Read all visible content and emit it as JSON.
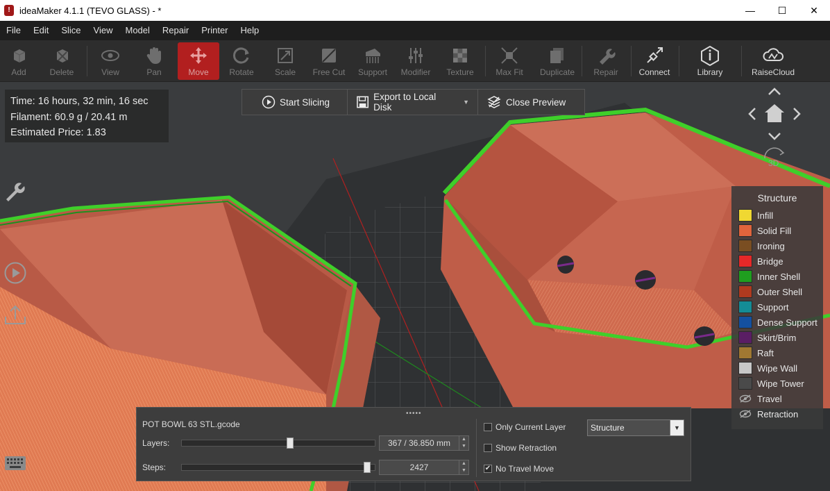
{
  "window": {
    "title": "ideaMaker 4.1.1 (TEVO GLASS) - *",
    "app_icon_glyph": "!",
    "controls": {
      "minimize": "—",
      "maximize": "☐",
      "close": "✕"
    }
  },
  "menu": [
    "File",
    "Edit",
    "Slice",
    "View",
    "Model",
    "Repair",
    "Printer",
    "Help"
  ],
  "toolbar": [
    {
      "label": "Add",
      "icon": "add-model-icon",
      "state": "disabled"
    },
    {
      "label": "Delete",
      "icon": "delete-model-icon",
      "state": "disabled"
    },
    {
      "label": "View",
      "icon": "eye-icon",
      "state": "disabled"
    },
    {
      "label": "Pan",
      "icon": "hand-icon",
      "state": "disabled"
    },
    {
      "label": "Move",
      "icon": "move-arrows-icon",
      "state": "active"
    },
    {
      "label": "Rotate",
      "icon": "rotate-icon",
      "state": "disabled"
    },
    {
      "label": "Scale",
      "icon": "scale-icon",
      "state": "disabled"
    },
    {
      "label": "Free Cut",
      "icon": "cut-icon",
      "state": "disabled"
    },
    {
      "label": "Support",
      "icon": "support-icon",
      "state": "disabled"
    },
    {
      "label": "Modifier",
      "icon": "modifier-icon",
      "state": "disabled"
    },
    {
      "label": "Texture",
      "icon": "texture-icon",
      "state": "disabled"
    },
    {
      "label": "Max Fit",
      "icon": "max-fit-icon",
      "state": "disabled"
    },
    {
      "label": "Duplicate",
      "icon": "duplicate-icon",
      "state": "disabled"
    },
    {
      "label": "Repair",
      "icon": "wrench-icon",
      "state": "disabled"
    },
    {
      "label": "Connect",
      "icon": "connect-icon",
      "state": "enabled"
    },
    {
      "label": "Library",
      "icon": "library-icon",
      "state": "enabled"
    },
    {
      "label": "RaiseCloud",
      "icon": "cloud-icon",
      "state": "enabled"
    }
  ],
  "info": {
    "time": "Time: 16 hours, 32 min, 16 sec",
    "filament": "Filament: 60.9 g / 20.41 m",
    "price": "Estimated Price: 1.83"
  },
  "slice_bar": {
    "start": "Start Slicing",
    "export": "Export to Local Disk",
    "close": "Close Preview"
  },
  "view3d_label": "3D",
  "legend": {
    "title": "Structure",
    "items": [
      {
        "label": "Infill",
        "color": "#f0d832"
      },
      {
        "label": "Solid Fill",
        "color": "#e0643c"
      },
      {
        "label": "Ironing",
        "color": "#7a4e22"
      },
      {
        "label": "Bridge",
        "color": "#e62828"
      },
      {
        "label": "Inner Shell",
        "color": "#1f9e1f"
      },
      {
        "label": "Outer Shell",
        "color": "#b03a1f"
      },
      {
        "label": "Support",
        "color": "#148c96"
      },
      {
        "label": "Dense Support",
        "color": "#1450a0"
      },
      {
        "label": "Skirt/Brim",
        "color": "#5a1e64"
      },
      {
        "label": "Raft",
        "color": "#a07832"
      },
      {
        "label": "Wipe Wall",
        "color": "#c8c8c8"
      },
      {
        "label": "Wipe Tower",
        "color": "#4a4a4a"
      },
      {
        "label": "Travel",
        "icon": "hidden-eye-icon"
      },
      {
        "label": "Retraction",
        "icon": "hidden-eye-icon"
      }
    ]
  },
  "preview_panel": {
    "grip": "•••••",
    "filename": "POT BOWL 63 STL.gcode",
    "layers_label": "Layers:",
    "layers_value": "367 / 36.850 mm",
    "layers_fraction": 0.56,
    "steps_label": "Steps:",
    "steps_value": "2427",
    "steps_fraction": 0.97,
    "only_current_layer": {
      "label": "Only Current Layer",
      "checked": false
    },
    "show_retraction": {
      "label": "Show Retraction",
      "checked": false
    },
    "no_travel_move": {
      "label": "No Travel Move",
      "checked": true,
      "mark": "✔"
    },
    "display_mode": "Structure",
    "dropdown_arrow": "▼"
  },
  "spin_arrows": {
    "up": "▲",
    "down": "▼"
  }
}
